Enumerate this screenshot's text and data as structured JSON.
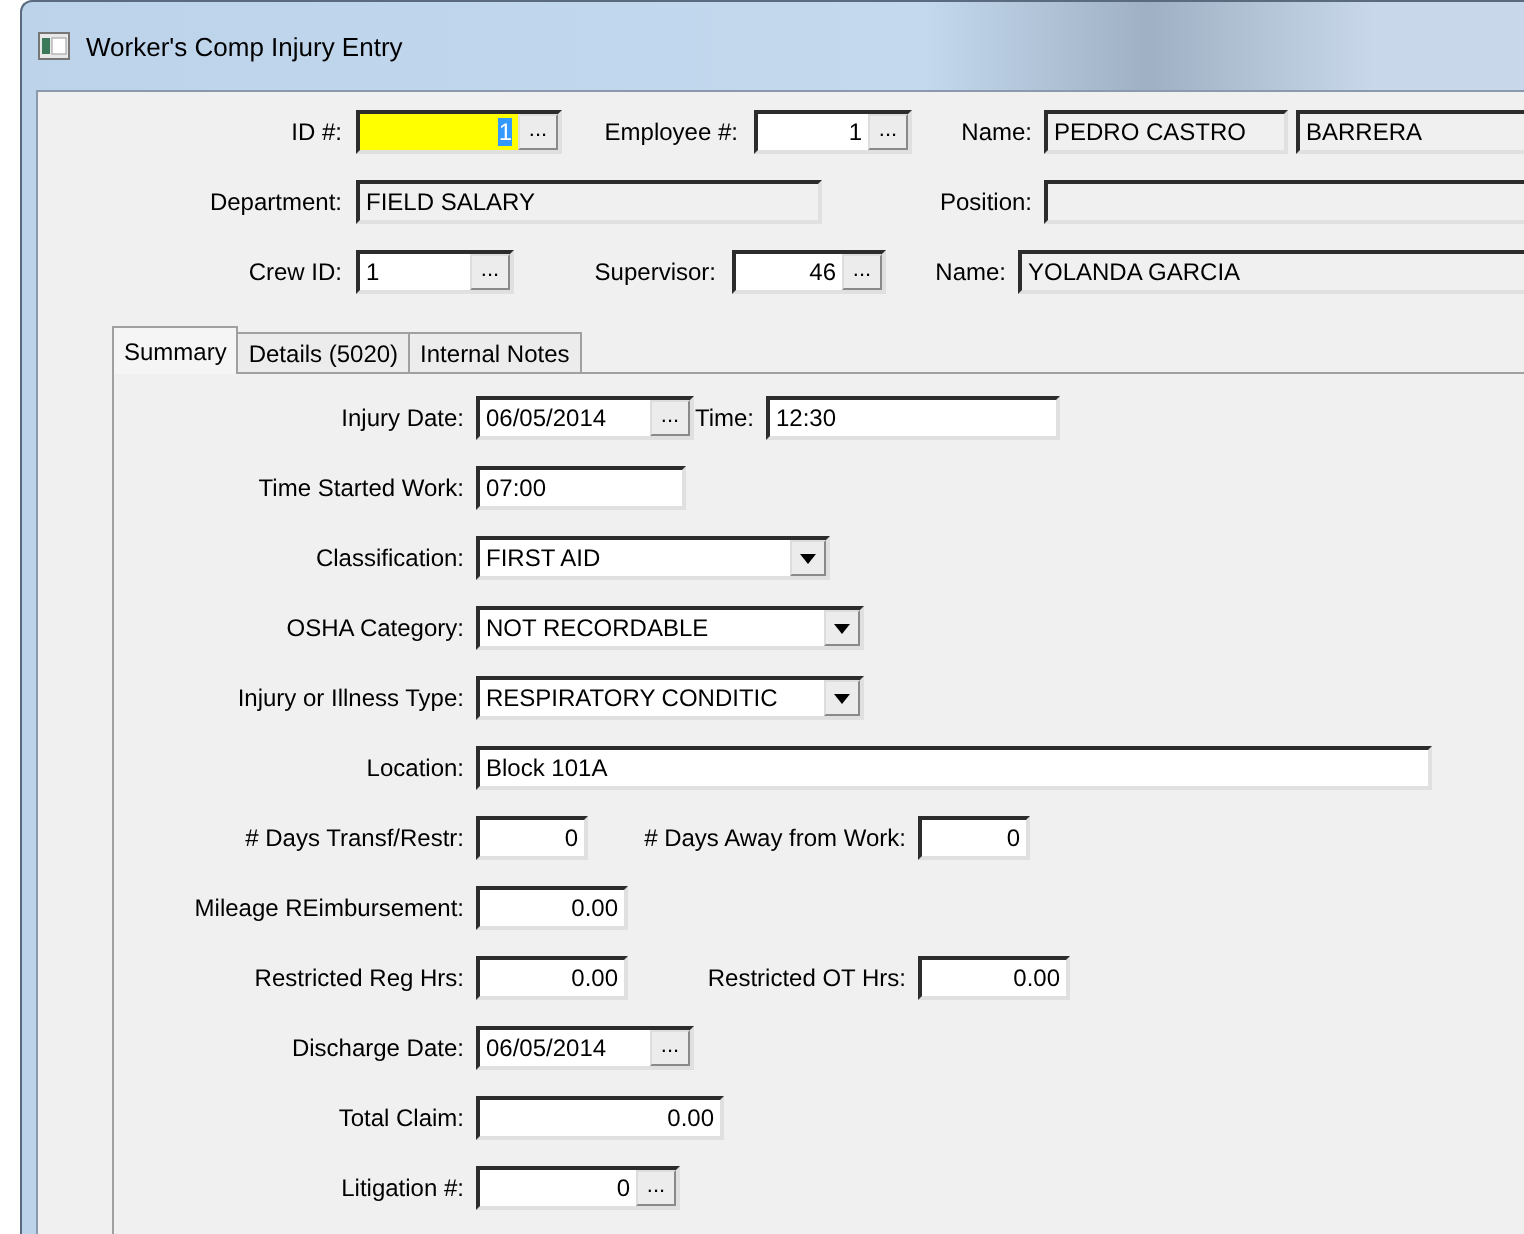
{
  "window": {
    "title": "Worker's Comp Injury Entry"
  },
  "header_rows": [
    [
      {
        "label": "ID #:",
        "value": "1",
        "kind": "lookup",
        "button": "...",
        "highlighted": true,
        "text_selected": true
      },
      {
        "label": "Employee #:",
        "value": "1",
        "kind": "lookup",
        "button": "...",
        "highlighted": false,
        "text_selected": false
      },
      {
        "label": "Name:",
        "value": "PEDRO CASTRO",
        "kind": "readonly",
        "highlighted": false,
        "text_selected": false
      },
      {
        "value": "BARRERA",
        "kind": "readonly",
        "highlighted": false,
        "text_selected": false
      }
    ],
    [
      {
        "label": "Department:",
        "value": "FIELD SALARY",
        "kind": "readonly",
        "highlighted": false,
        "text_selected": false
      },
      {
        "label": "Position:",
        "kind": "readonly",
        "highlighted": false
      }
    ],
    [
      {
        "label": "Crew ID:",
        "value": "1",
        "kind": "lookup",
        "button": "...",
        "highlighted": false,
        "text_selected": false
      },
      {
        "label": "Supervisor:",
        "value": "46",
        "kind": "lookup",
        "button": "...",
        "highlighted": false,
        "text_selected": false
      },
      {
        "label": "Name:",
        "value": "YOLANDA GARCIA",
        "kind": "readonly",
        "highlighted": false,
        "text_selected": false
      }
    ]
  ],
  "tabs": [
    {
      "label": "Summary",
      "selected": true
    },
    {
      "label": "Details (5020)",
      "selected": false
    },
    {
      "label": "Internal Notes",
      "selected": false
    }
  ],
  "summary_rows": [
    [
      {
        "label": "Injury Date:",
        "value": "06/05/2014",
        "kind": "lookup",
        "button": "..."
      },
      {
        "label": "Time:",
        "value": "12:30",
        "kind": "text"
      }
    ],
    [
      {
        "label": "Time Started Work:",
        "value": "07:00",
        "kind": "text"
      }
    ],
    [
      {
        "label": "Classification:",
        "value": "FIRST AID",
        "kind": "select"
      }
    ],
    [
      {
        "label": "OSHA Category:",
        "value": "NOT RECORDABLE",
        "kind": "select"
      }
    ],
    [
      {
        "label": "Injury or Illness Type:",
        "value": "RESPIRATORY CONDITIC",
        "kind": "select"
      }
    ],
    [
      {
        "label": "Location:",
        "value": "Block 101A",
        "kind": "text"
      }
    ],
    [
      {
        "label": "# Days Transf/Restr:",
        "value": "0",
        "kind": "text"
      },
      {
        "label": "# Days Away from Work:",
        "value": "0",
        "kind": "text"
      }
    ],
    [
      {
        "label": "Mileage REimbursement:",
        "value": "0.00",
        "kind": "text"
      }
    ],
    [
      {
        "label": "Restricted Reg Hrs:",
        "value": "0.00",
        "kind": "text"
      },
      {
        "label": "Restricted OT Hrs:",
        "value": "0.00",
        "kind": "text"
      }
    ],
    [
      {
        "label": "Discharge Date:",
        "value": "06/05/2014",
        "kind": "lookup",
        "button": "..."
      }
    ],
    [
      {
        "label": "Total Claim:",
        "value": "0.00",
        "kind": "text"
      }
    ],
    [
      {
        "label": "Litigation #:",
        "value": "0",
        "kind": "lookup",
        "button": "..."
      }
    ]
  ]
}
